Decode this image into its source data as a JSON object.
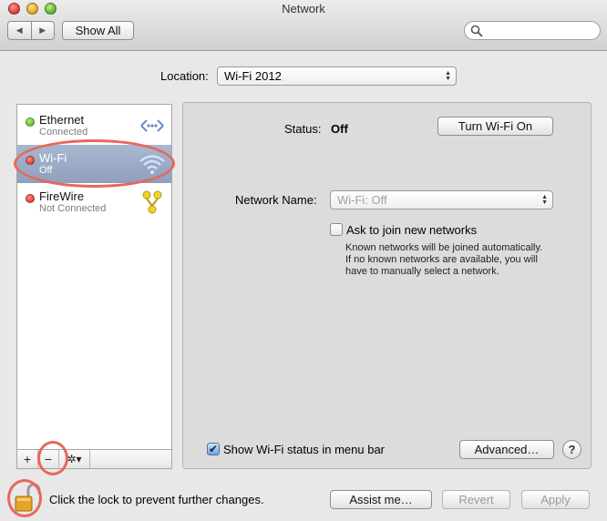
{
  "window": {
    "title": "Network"
  },
  "toolbar": {
    "back_icon": "back-arrow-icon",
    "forward_icon": "forward-arrow-icon",
    "back_glyph": "◀",
    "forward_glyph": "▶",
    "show_all_label": "Show All",
    "search": {
      "value": "",
      "icon": "search-icon"
    }
  },
  "location": {
    "label": "Location:",
    "value": "Wi-Fi 2012"
  },
  "sidebar": {
    "services": [
      {
        "name": "Ethernet",
        "status": "Connected",
        "status_color": "green",
        "icon": "ethernet-icon"
      },
      {
        "name": "Wi-Fi",
        "status": "Off",
        "status_color": "red",
        "icon": "wifi-icon",
        "selected": true
      },
      {
        "name": "FireWire",
        "status": "Not Connected",
        "status_color": "red",
        "icon": "firewire-icon"
      }
    ],
    "add_glyph": "+",
    "remove_glyph": "−",
    "action_glyph": "✲▾"
  },
  "detail": {
    "status_label": "Status:",
    "status_value": "Off",
    "turn_on_label": "Turn Wi-Fi On",
    "network_name_label": "Network Name:",
    "network_name_value": "Wi-Fi: Off",
    "ask_join_label": "Ask to join new networks",
    "ask_join_checked": false,
    "ask_join_help": [
      "Known networks will be joined automatically.",
      "If no known networks are available, you will",
      "have to manually select a network."
    ],
    "show_status_label": "Show Wi-Fi status in menu bar",
    "show_status_checked": true,
    "advanced_label": "Advanced…",
    "help_glyph": "?"
  },
  "footer": {
    "lock_text": "Click the lock to prevent further changes.",
    "lock_icon": "unlocked-padlock-icon",
    "assist_label": "Assist me…",
    "revert_label": "Revert",
    "apply_label": "Apply"
  },
  "colors": {
    "selection": "#9aa9c5",
    "annotation": "#e8675a",
    "status_green": "#3cab1c",
    "status_red": "#d0221a"
  }
}
